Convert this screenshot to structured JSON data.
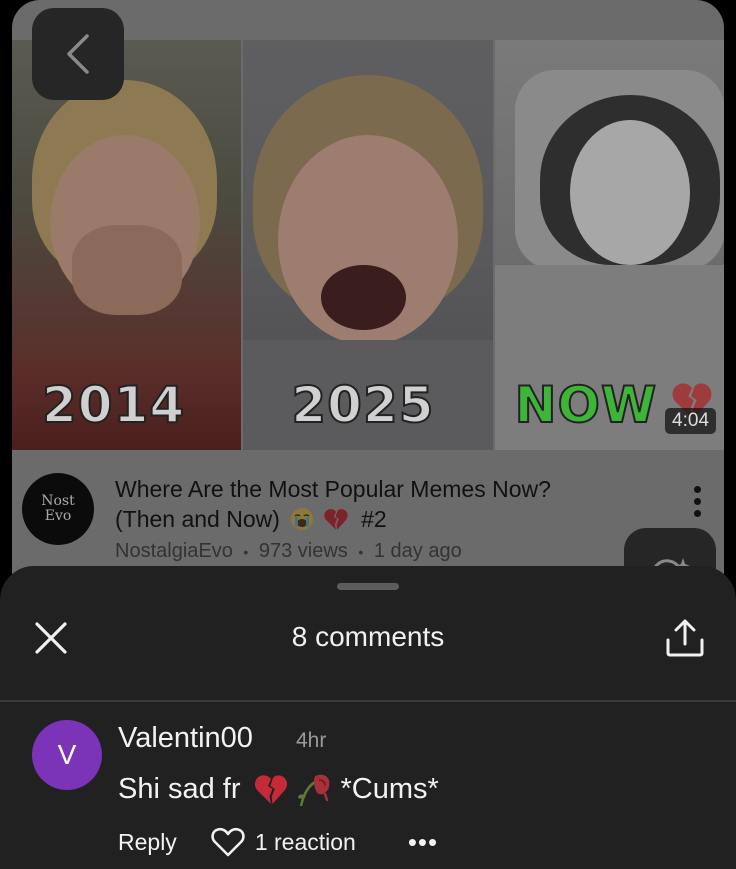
{
  "video": {
    "thumbnail_labels": [
      "2014",
      "2025",
      "NOW"
    ],
    "duration": "4:04",
    "channel_avatar_text": [
      "Nost",
      "Evo"
    ],
    "title_line1": "Where Are the Most Popular Memes Now?",
    "title_line2": "(Then and Now)",
    "title_suffix": "#2",
    "channel": "NostalgiaEvo",
    "views": "973 views",
    "age": "1 day ago",
    "separator": "•"
  },
  "sheet": {
    "title": "8 comments"
  },
  "comments": [
    {
      "avatar_letter": "V",
      "avatar_color": "#7b33b7",
      "username": "Valentin00",
      "time": "4hr",
      "text_start": "Shi sad fr",
      "text_end": "*Cums*",
      "reply_label": "Reply",
      "reaction_label": "1 reaction",
      "more_label": "•••"
    }
  ],
  "colors": {
    "sheet_bg": "#212121",
    "now_green": "#3db537",
    "broken_heart": "#c42a38"
  },
  "icons": [
    "back-icon",
    "kebab-icon",
    "close-icon",
    "share-icon",
    "heart-outline-icon",
    "broken-heart-icon",
    "crying-face-icon",
    "wilted-rose-icon"
  ]
}
